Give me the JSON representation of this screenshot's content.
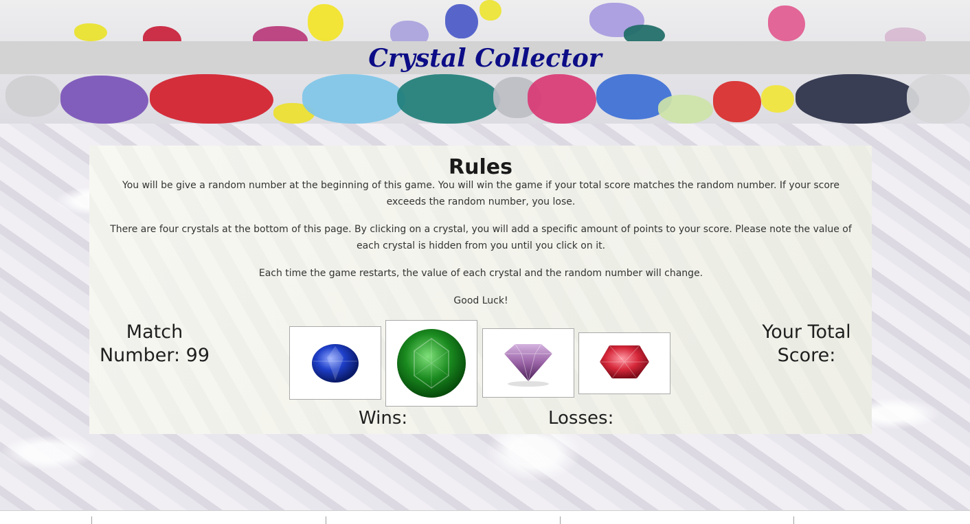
{
  "header": {
    "title": "Crystal Collector"
  },
  "rules": {
    "title": "Rules",
    "paragraphs": [
      "You will be give a random number at the beginning of this game. You will win the game if your total score matches the random number. If your score exceeds the random number, you lose.",
      "There are four crystals at the bottom of this page. By clicking on a crystal, you will add a specific amount of points to your score. Please note the value of each crystal is hidden from you until you click on it.",
      "Each time the game restarts, the value of each crystal and the random number will change.",
      "Good Luck!"
    ]
  },
  "game": {
    "match_label": "Match Number: 99",
    "match_number": 99,
    "total_score_label": "Your Total Score:",
    "wins_label": "Wins:",
    "losses_label": "Losses:"
  },
  "crystals": [
    {
      "name": "blue-sapphire",
      "color": "#1e3fc8"
    },
    {
      "name": "green-emerald",
      "color": "#1a8a1f"
    },
    {
      "name": "purple-amethyst",
      "color": "#9a63a6"
    },
    {
      "name": "red-ruby",
      "color": "#d6283a"
    }
  ],
  "colors": {
    "title": "#0c0d86",
    "title_band": "#d3d3d3"
  }
}
